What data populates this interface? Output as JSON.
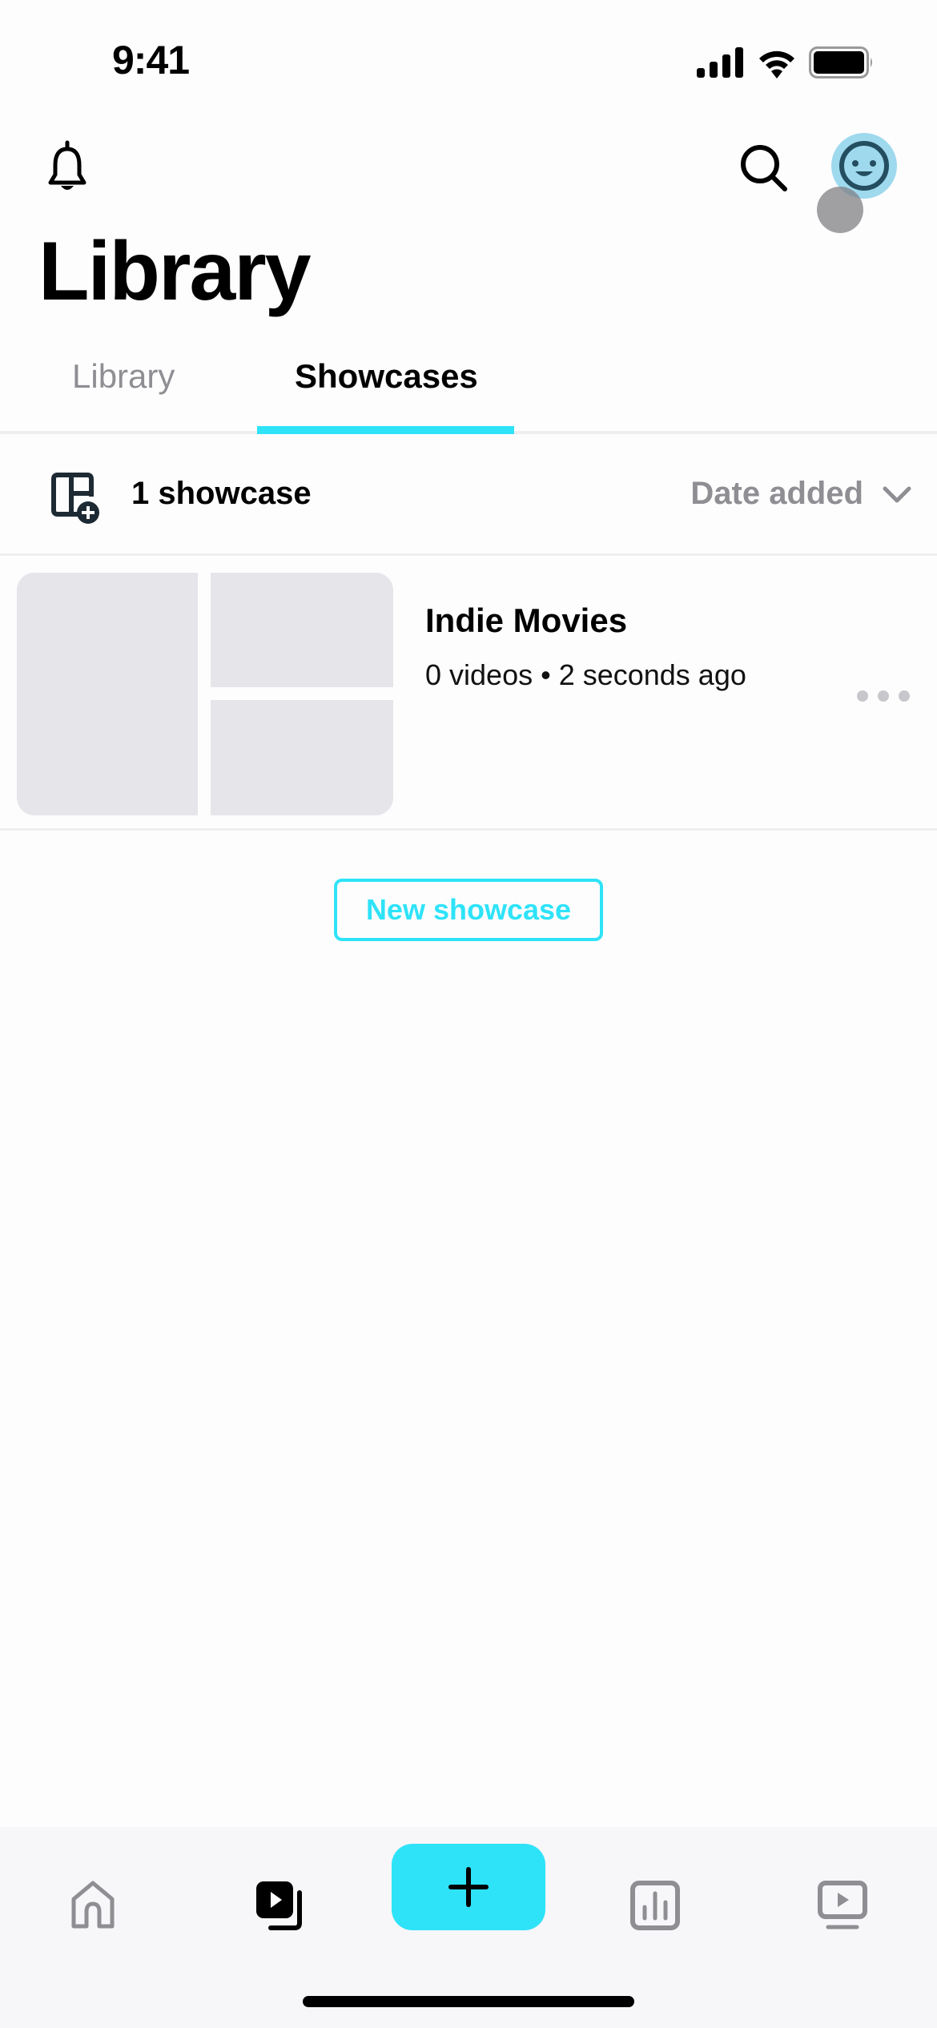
{
  "status_bar": {
    "time": "9:41",
    "icons": [
      "cellular-signal-icon",
      "wifi-icon",
      "battery-icon"
    ]
  },
  "header": {
    "title": "Library",
    "left_icon": "bell-icon",
    "right_icons": [
      "search-icon",
      "avatar-smiley-icon"
    ]
  },
  "tabs": [
    {
      "label": "Library",
      "active": false
    },
    {
      "label": "Showcases",
      "active": true
    }
  ],
  "toolbar": {
    "add_icon": "add-showcase-icon",
    "count_label": "1 showcase",
    "sort_label": "Date added",
    "sort_icon": "chevron-down-icon"
  },
  "showcases": [
    {
      "title": "Indie Movies",
      "meta": "0 videos • 2 seconds ago",
      "more_icon": "more-horizontal-icon"
    }
  ],
  "new_showcase_button": "New showcase",
  "bottom_nav": {
    "items": [
      {
        "icon": "home-icon",
        "active": false
      },
      {
        "icon": "video-library-icon",
        "active": true
      },
      {
        "icon": "plus-icon",
        "active": false
      },
      {
        "icon": "analytics-icon",
        "active": false
      },
      {
        "icon": "watch-tv-icon",
        "active": false
      }
    ]
  },
  "colors": {
    "accent": "#2ee3f8",
    "inactive": "#8e8e93",
    "thumb_placeholder": "#e5e5ea",
    "avatar_bg": "#9ed9ee"
  }
}
